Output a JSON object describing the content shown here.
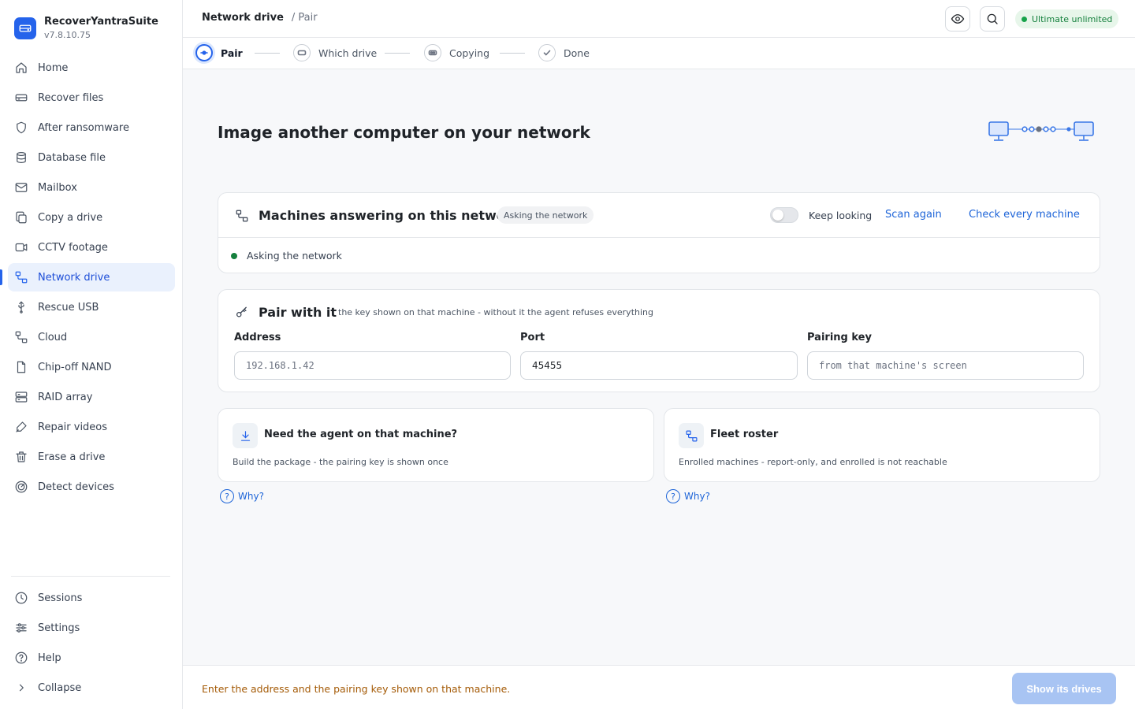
{
  "app": {
    "name": "RecoverYantraSuite",
    "version": "v7.8.10.75"
  },
  "sidebar": {
    "items": [
      {
        "label": "Home",
        "icon": "home-icon"
      },
      {
        "label": "Recover files",
        "icon": "drive-icon"
      },
      {
        "label": "After ransomware",
        "icon": "shield-icon"
      },
      {
        "label": "Database file",
        "icon": "database-icon"
      },
      {
        "label": "Mailbox",
        "icon": "mail-icon"
      },
      {
        "label": "Copy a drive",
        "icon": "copy-icon"
      },
      {
        "label": "CCTV footage",
        "icon": "video-icon"
      },
      {
        "label": "Network drive",
        "icon": "network-icon",
        "active": true
      },
      {
        "label": "Rescue USB",
        "icon": "usb-icon"
      },
      {
        "label": "Cloud",
        "icon": "cloud-network-icon"
      },
      {
        "label": "Chip-off NAND",
        "icon": "chip-file-icon"
      },
      {
        "label": "RAID array",
        "icon": "raid-icon"
      },
      {
        "label": "Repair videos",
        "icon": "wrench-icon"
      },
      {
        "label": "Erase a drive",
        "icon": "trash-icon"
      },
      {
        "label": "Detect devices",
        "icon": "radar-icon"
      }
    ],
    "bottom": [
      {
        "label": "Sessions",
        "icon": "clock-icon"
      },
      {
        "label": "Settings",
        "icon": "sliders-icon"
      },
      {
        "label": "Help",
        "icon": "help-icon"
      },
      {
        "label": "Collapse",
        "icon": "chevron-right-icon"
      }
    ]
  },
  "header": {
    "breadcrumb_main": "Network drive",
    "breadcrumb_sub": "/ Pair",
    "plan_badge": "Ultimate  unlimited",
    "accent_color": "#2563eb"
  },
  "steps": [
    {
      "label": "Pair",
      "active": true
    },
    {
      "label": "Which drive"
    },
    {
      "label": "Copying"
    },
    {
      "label": "Done"
    }
  ],
  "main": {
    "title": "Image another computer on your network",
    "machines": {
      "title": "Machines answering on this network",
      "pill": "Asking the network",
      "keep_looking": "Keep looking",
      "scan_again": "Scan again",
      "check_every": "Check every machine",
      "status": "Asking the network"
    },
    "pair": {
      "title": "Pair with it",
      "subtitle": "the key shown on that machine - without it the agent refuses everything",
      "address_label": "Address",
      "address_placeholder": "192.168.1.42",
      "port_label": "Port",
      "port_value": "45455",
      "key_label": "Pairing key",
      "key_placeholder": "from that machine's screen"
    },
    "agent_card": {
      "title": "Need the agent on that machine?",
      "desc": "Build the package - the pairing key is shown once",
      "why": "Why?"
    },
    "fleet_card": {
      "title": "Fleet roster",
      "desc": "Enrolled machines - report-only, and enrolled is not reachable",
      "why": "Why?"
    }
  },
  "footer": {
    "message": "Enter the address and the pairing key shown on that machine.",
    "primary_button": "Show its drives"
  }
}
